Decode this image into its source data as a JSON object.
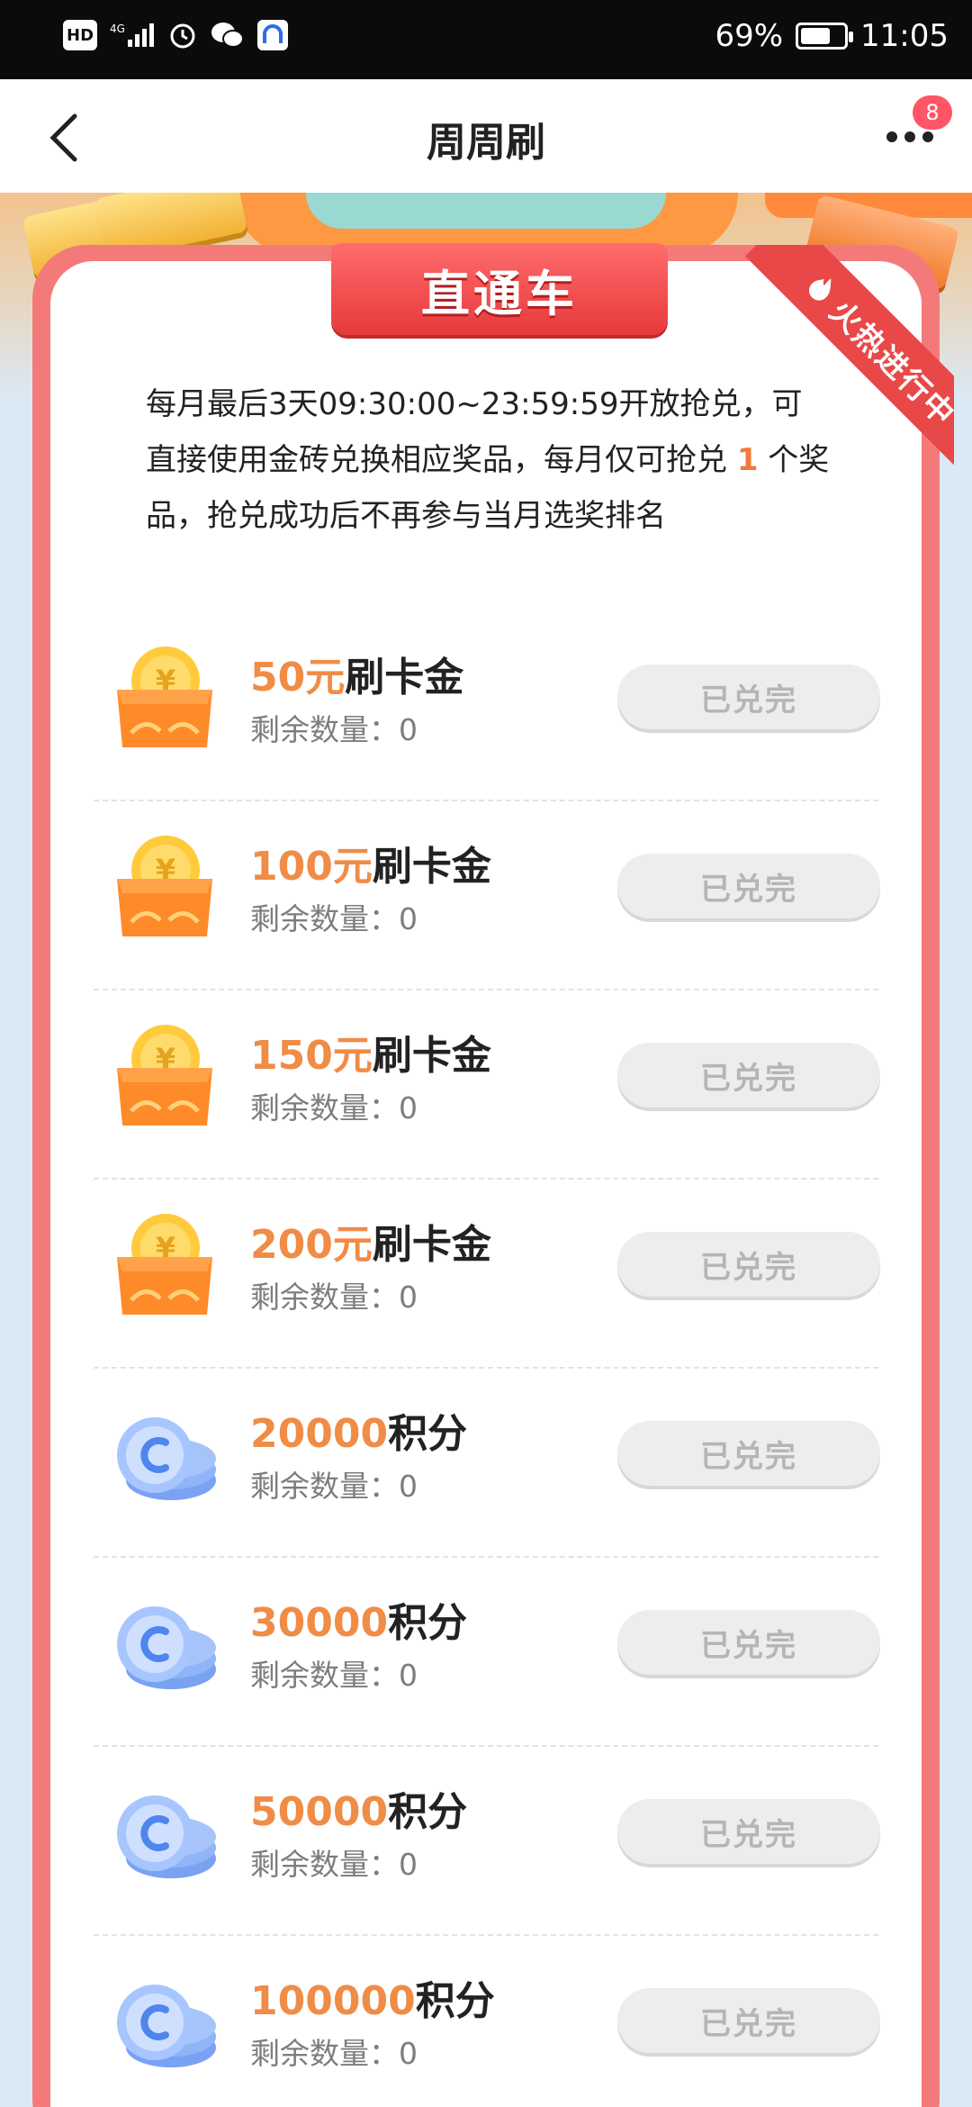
{
  "status_bar": {
    "left_icons": [
      "hd-icon",
      "signal-4g-icon",
      "alarm-icon",
      "wechat-icon",
      "app-icon"
    ],
    "battery_percent": "69%",
    "battery_level": 0.69,
    "time": "11:05"
  },
  "nav": {
    "title": "周周刷",
    "badge_count": "8"
  },
  "card": {
    "header": "直通车",
    "ribbon": "火热进行中",
    "description_parts": {
      "before": "每月最后3天09:30:00~23:59:59开放抢兑，可直接使用金砖兑换相应奖品，每月仅可抢兑 ",
      "highlight": "1",
      "after": " 个奖品，抢兑成功后不再参与当月选奖排名"
    }
  },
  "rewards": [
    {
      "amount": "50元",
      "name": "刷卡金",
      "remain_label": "剩余数量：",
      "remain": "0",
      "button": "已兑完",
      "icon": "gold-coin-gift-icon"
    },
    {
      "amount": "100元",
      "name": "刷卡金",
      "remain_label": "剩余数量：",
      "remain": "0",
      "button": "已兑完",
      "icon": "gold-coin-gift-icon"
    },
    {
      "amount": "150元",
      "name": "刷卡金",
      "remain_label": "剩余数量：",
      "remain": "0",
      "button": "已兑完",
      "icon": "gold-coin-gift-icon"
    },
    {
      "amount": "200元",
      "name": "刷卡金",
      "remain_label": "剩余数量：",
      "remain": "0",
      "button": "已兑完",
      "icon": "gold-coin-gift-icon"
    },
    {
      "amount": "20000",
      "name": "积分",
      "remain_label": "剩余数量：",
      "remain": "0",
      "button": "已兑完",
      "icon": "blue-points-coin-icon"
    },
    {
      "amount": "30000",
      "name": "积分",
      "remain_label": "剩余数量：",
      "remain": "0",
      "button": "已兑完",
      "icon": "blue-points-coin-icon"
    },
    {
      "amount": "50000",
      "name": "积分",
      "remain_label": "剩余数量：",
      "remain": "0",
      "button": "已兑完",
      "icon": "blue-points-coin-icon"
    },
    {
      "amount": "100000",
      "name": "积分",
      "remain_label": "剩余数量：",
      "remain": "0",
      "button": "已兑完",
      "icon": "blue-points-coin-icon"
    }
  ],
  "colors": {
    "accent_orange": "#f08c46",
    "card_border": "#f47a7a",
    "header_red": "#e7393b",
    "button_disabled": "#ededed"
  }
}
